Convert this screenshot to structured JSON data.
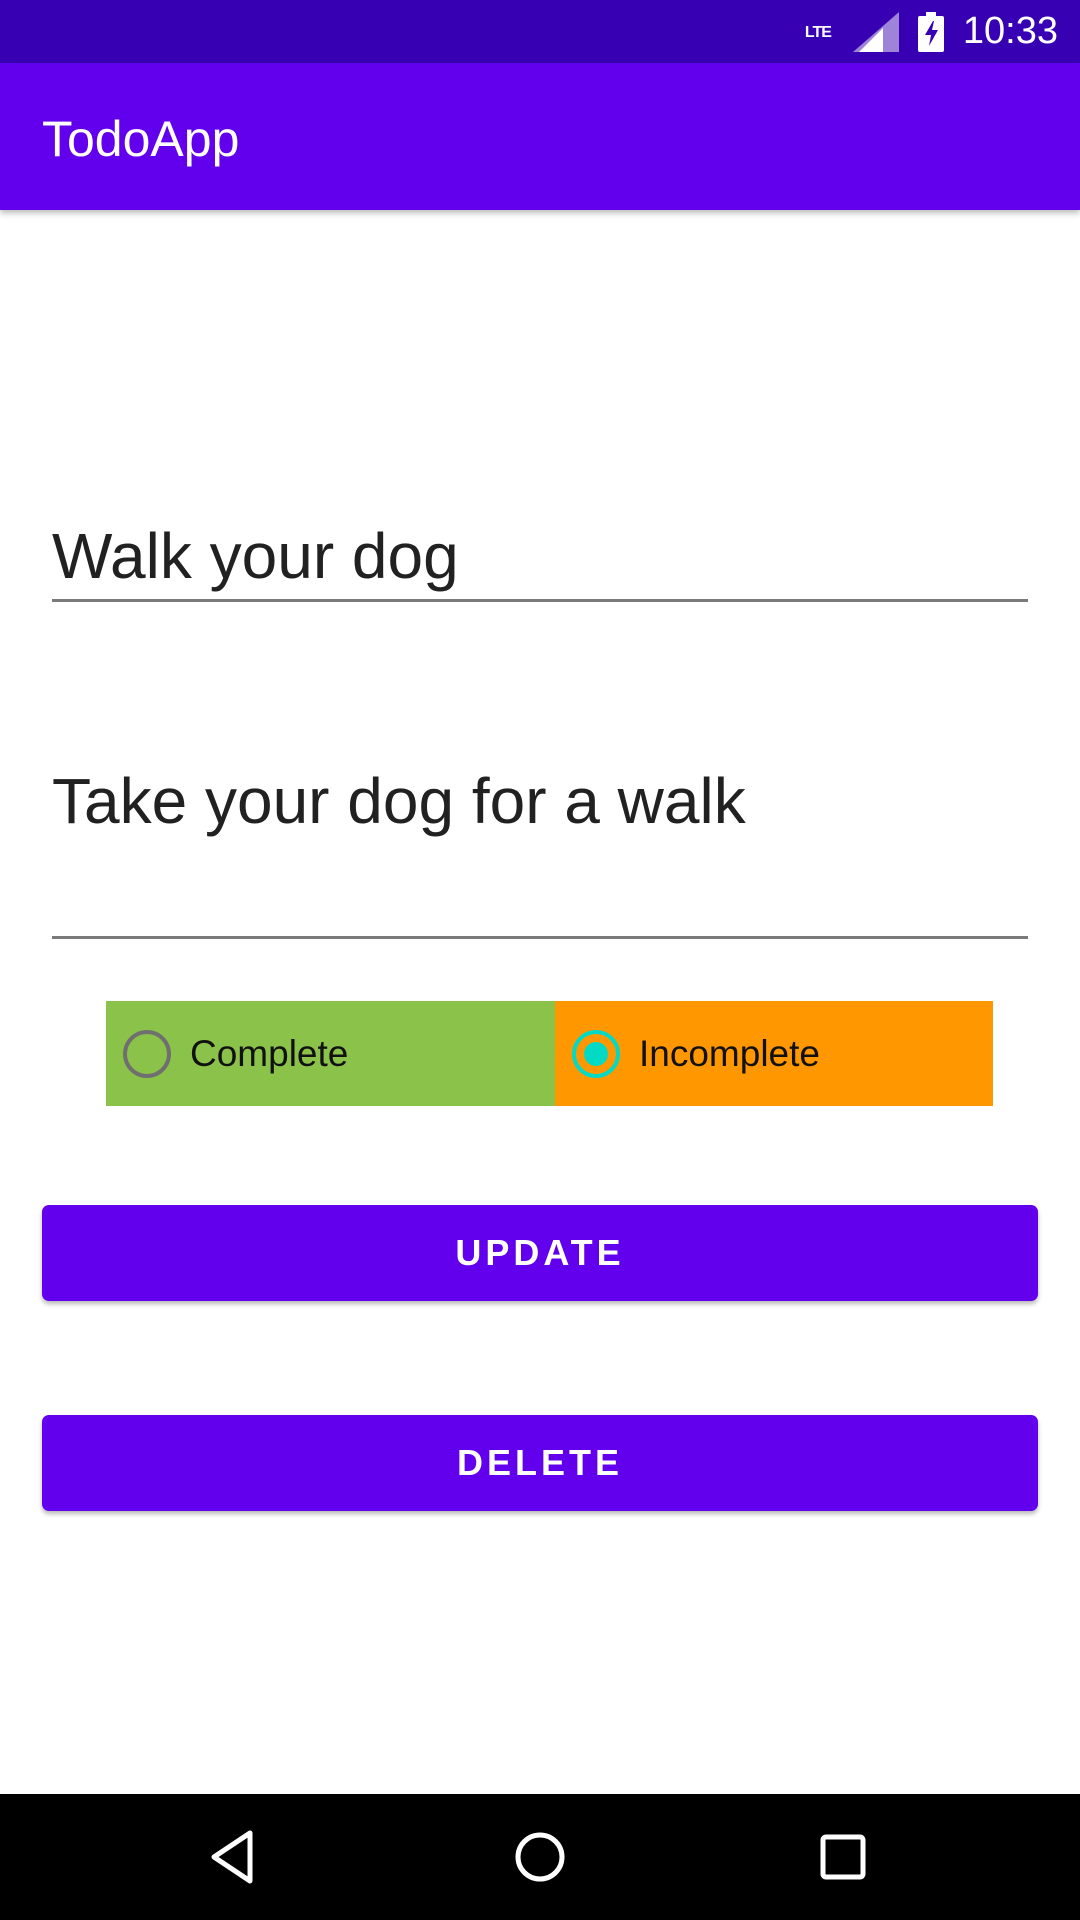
{
  "status_bar": {
    "network": "LTE",
    "time": "10:33",
    "icons": [
      "signal-icon",
      "battery-charging-icon"
    ]
  },
  "app_bar": {
    "title": "TodoApp"
  },
  "form": {
    "title_value": "Walk your dog",
    "description_value": "Take your dog for a walk"
  },
  "status_options": {
    "complete_label": "Complete",
    "incomplete_label": "Incomplete",
    "selected": "Incomplete",
    "complete_color": "#8bc34a",
    "incomplete_color": "#ff9800",
    "radio_accent": "#03dac5"
  },
  "actions": {
    "update_label": "UPDATE",
    "delete_label": "DELETE"
  },
  "nav_bar": {
    "icons": [
      "back-icon",
      "home-icon",
      "recents-icon"
    ]
  },
  "colors": {
    "primary": "#6200ee",
    "primary_dark": "#3700b3"
  }
}
